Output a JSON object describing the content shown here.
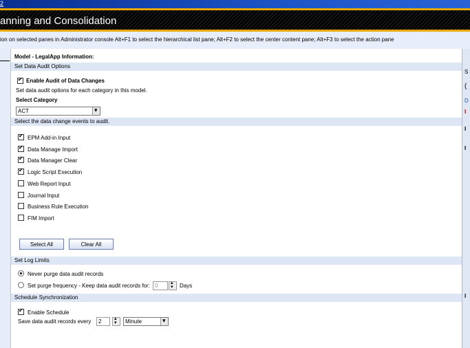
{
  "window": {
    "top_mark": "2",
    "title": "anning and Consolidation"
  },
  "hint": "ion on selected panes in Administrator console  Alt+F1 to select the hierarchical list pane; Alt+F2 to select the center content pane; Alt+F3 to select the action pane",
  "model_heading": "Model - LegalApp Information:",
  "sections": {
    "audit_options": "Set Data Audit Options",
    "events": "Select the data change events to audit.",
    "log_limits": "Set Log Limits",
    "schedule": "Schedule Synchronization"
  },
  "enable_audit": {
    "label": "Enable Audit of Data Changes",
    "checked": true
  },
  "audit_desc": "Set data audit  options for each category in this model.",
  "category": {
    "label": "Select Category",
    "value": "ACT"
  },
  "events": [
    {
      "label": "EPM Add-in Input",
      "checked": true
    },
    {
      "label": "Data Manage Import",
      "checked": true
    },
    {
      "label": "Data Manager Clear",
      "checked": true
    },
    {
      "label": "Logic Script Execution",
      "checked": true
    },
    {
      "label": "Web Report Input",
      "checked": false
    },
    {
      "label": "Journal Input",
      "checked": false
    },
    {
      "label": "Business Rule Execution",
      "checked": false
    },
    {
      "label": "FIM Import",
      "checked": false
    }
  ],
  "buttons": {
    "select_all": "Select All",
    "clear_all": "Clear All"
  },
  "log_limits": {
    "never_label": "Never purge data audit records",
    "never_selected": true,
    "purge_label": "Set purge frequency - Keep data audit records for:",
    "purge_value": "0",
    "days_label": "Days"
  },
  "schedule": {
    "enable_label": "Enable Schedule",
    "enable_checked": true,
    "save_label": "Save data audit records every",
    "interval_value": "2",
    "unit_value": "Minute"
  },
  "right_pane": {
    "letters": [
      "S",
      "(",
      "D",
      "I",
      "I",
      "I",
      "I"
    ]
  },
  "colors": {
    "accent_gold": "#e8a800",
    "section_bg": "#dde6f4",
    "title_bg": "#000000"
  }
}
